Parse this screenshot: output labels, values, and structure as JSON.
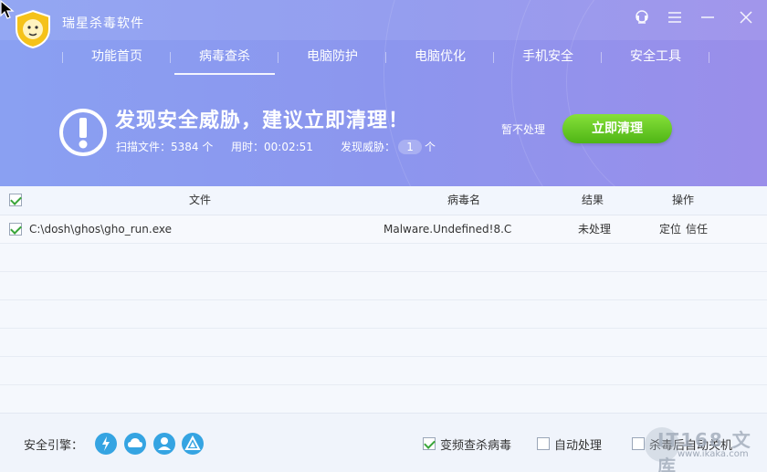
{
  "app": {
    "title": "瑞星杀毒软件"
  },
  "nav": [
    {
      "label": "功能首页",
      "active": false
    },
    {
      "label": "病毒查杀",
      "active": true
    },
    {
      "label": "电脑防护",
      "active": false
    },
    {
      "label": "电脑优化",
      "active": false
    },
    {
      "label": "手机安全",
      "active": false
    },
    {
      "label": "安全工具",
      "active": false
    }
  ],
  "alert": {
    "title": "发现安全威胁，建议立即清理！",
    "scanned_label": "扫描文件：5384 个",
    "time_label": "用时：00:02:51",
    "threat_label": "发现威胁：",
    "threat_count": "1",
    "threat_unit": "个",
    "ignore_label": "暂不处理",
    "clean_label": "立即清理"
  },
  "table": {
    "headers": {
      "file": "文件",
      "virus": "病毒名",
      "result": "结果",
      "action": "操作"
    },
    "rows": [
      {
        "checked": true,
        "file": "C:\\dosh\\ghos\\gho_run.exe",
        "virus": "Malware.Undefined!8.C",
        "result": "未处理",
        "action_locate": "定位",
        "action_trust": "信任"
      }
    ]
  },
  "footer": {
    "engine_label": "安全引擎：",
    "engines": [
      "lightning-icon",
      "cloud-icon",
      "user-icon",
      "triangle-icon"
    ],
    "options": [
      {
        "label": "变频查杀病毒",
        "checked": true
      },
      {
        "label": "自动处理",
        "checked": false
      },
      {
        "label": "杀毒后自动关机",
        "checked": false
      }
    ]
  },
  "watermark": {
    "main": "IT168 文库",
    "url": "www.ikaka.com"
  },
  "colors": {
    "header": "#8c96ee",
    "accent_green": "#4fb515",
    "link": "#4a7bd0",
    "engine": "#35a4e2"
  }
}
